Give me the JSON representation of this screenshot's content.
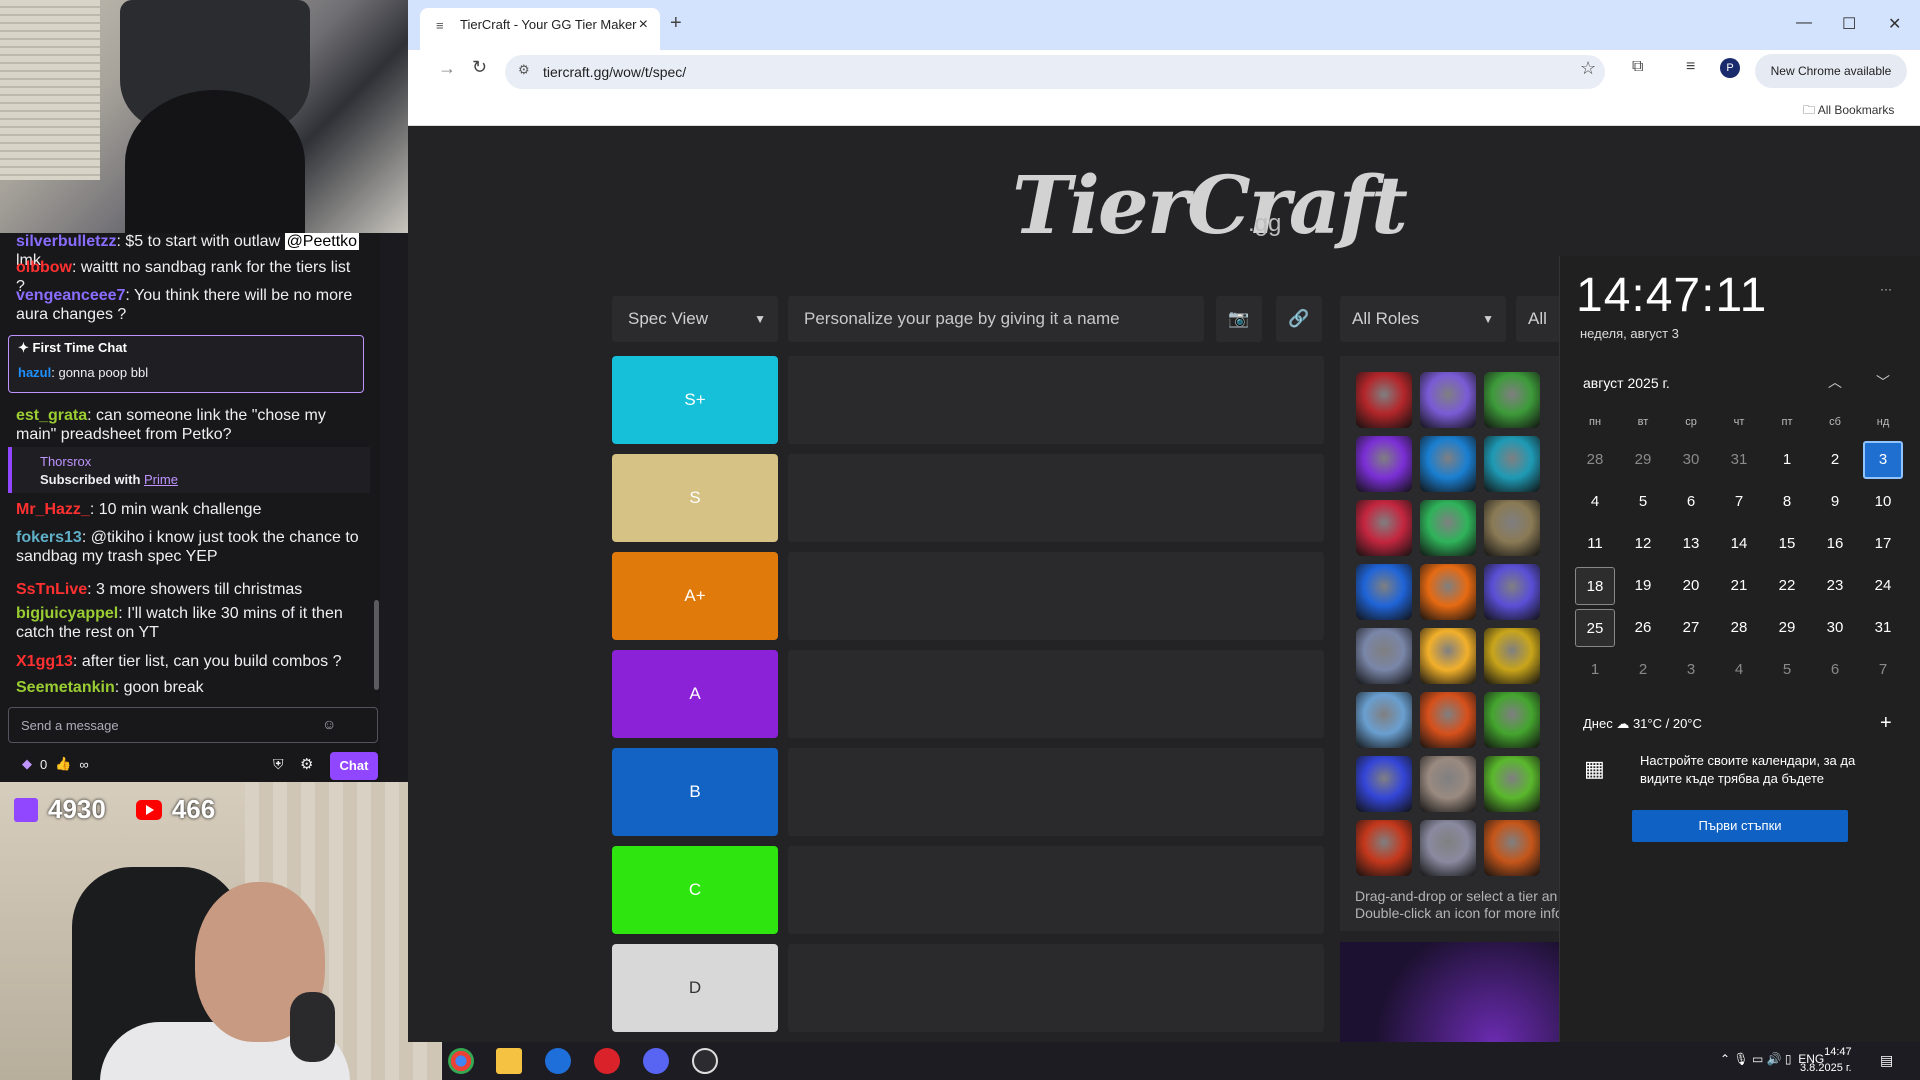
{
  "browser": {
    "tab_title": "TierCraft - Your GG Tier Maker",
    "url": "tiercraft.gg/wow/t/spec/",
    "new_chrome": "New Chrome available",
    "all_bookmarks": "All Bookmarks"
  },
  "site": {
    "logo": "TierCraft",
    "logo_suffix": ".gg",
    "spec_view": "Spec View",
    "name_placeholder": "Personalize your page by giving it a name",
    "all_roles": "All Roles",
    "all_partial": "All F",
    "help_line1": "Drag-and-drop or select a tier an",
    "help_line2": "Double-click an icon for more info",
    "tiers": [
      {
        "label": "S+",
        "color": "#16c0d8"
      },
      {
        "label": "S",
        "color": "#d5c284"
      },
      {
        "label": "A+",
        "color": "#e07a0b"
      },
      {
        "label": "A",
        "color": "#8c22d8"
      },
      {
        "label": "B",
        "color": "#1363c4"
      },
      {
        "label": "C",
        "color": "#2ee50f"
      },
      {
        "label": "D",
        "color": "#d8d8d8"
      }
    ]
  },
  "chat": {
    "messages": [
      {
        "user": "silverbulletzz",
        "color": "#8a6dff",
        "text": ": $5 to start with outlaw ",
        "mention": "@Peettko",
        "tail": " lmk"
      },
      {
        "user": "olbbow",
        "color": "#ff3030",
        "text": ": waittt no sandbag rank for the tiers list ?"
      },
      {
        "user": "vengeanceee7",
        "color": "#8a6dff",
        "text": ": You think there will be no more aura changes ?"
      },
      {
        "user": "est_grata",
        "color": "#9acd32",
        "text": ": can someone link the \"chose my main\" preadsheet from Petko?"
      },
      {
        "user": "Mr_Hazz_",
        "color": "#ff3030",
        "text": ": 10 min wank challenge"
      },
      {
        "user": "fokers13",
        "color": "#5fb0c8",
        "text": ": @tikiho i know just took the chance to sandbag my trash spec YEP"
      },
      {
        "user": "SsTnLive",
        "color": "#ff3030",
        "text": ": 3 more showers till christmas"
      },
      {
        "user": "bigjuicyappel",
        "color": "#9acd32",
        "text": ": I'll watch like 30 mins of it then catch the rest on YT"
      },
      {
        "user": "X1gg13",
        "color": "#ff3030",
        "text": ": after tier list, can you build combos ?"
      },
      {
        "user": "Seemetankin",
        "color": "#9acd32",
        "text": ": goon break"
      }
    ],
    "first_time_title": "First Time Chat",
    "first_time_user": "hazul",
    "first_time_text": ": gonna poop bbl",
    "sub_user": "Thorsrox",
    "sub_text": "Subscribed with ",
    "sub_link": "Prime",
    "input_placeholder": "Send a message",
    "chat_button": "Chat",
    "points": "0",
    "infinity": "∞"
  },
  "stream": {
    "twitch_viewers": "4930",
    "youtube_viewers": "466"
  },
  "calendar": {
    "time": "14:47:11",
    "date_full": "неделя, август 3",
    "month": "август 2025 г.",
    "dow": [
      "пн",
      "вт",
      "ср",
      "чт",
      "пт",
      "сб",
      "нд"
    ],
    "weeks": [
      [
        "28",
        "29",
        "30",
        "31",
        "1",
        "2",
        "3"
      ],
      [
        "4",
        "5",
        "6",
        "7",
        "8",
        "9",
        "10"
      ],
      [
        "11",
        "12",
        "13",
        "14",
        "15",
        "16",
        "17"
      ],
      [
        "18",
        "19",
        "20",
        "21",
        "22",
        "23",
        "24"
      ],
      [
        "25",
        "26",
        "27",
        "28",
        "29",
        "30",
        "31"
      ],
      [
        "1",
        "2",
        "3",
        "4",
        "5",
        "6",
        "7"
      ]
    ],
    "weather_label": "Днес",
    "weather": "31°C / 20°C",
    "info": "Настройте своите календари, за да видите къде трябва да бъдете",
    "button": "Първи стъпки",
    "more": "···"
  },
  "taskbar": {
    "lang": "ENG",
    "time": "14:47",
    "date": "3.8.2025 г."
  }
}
